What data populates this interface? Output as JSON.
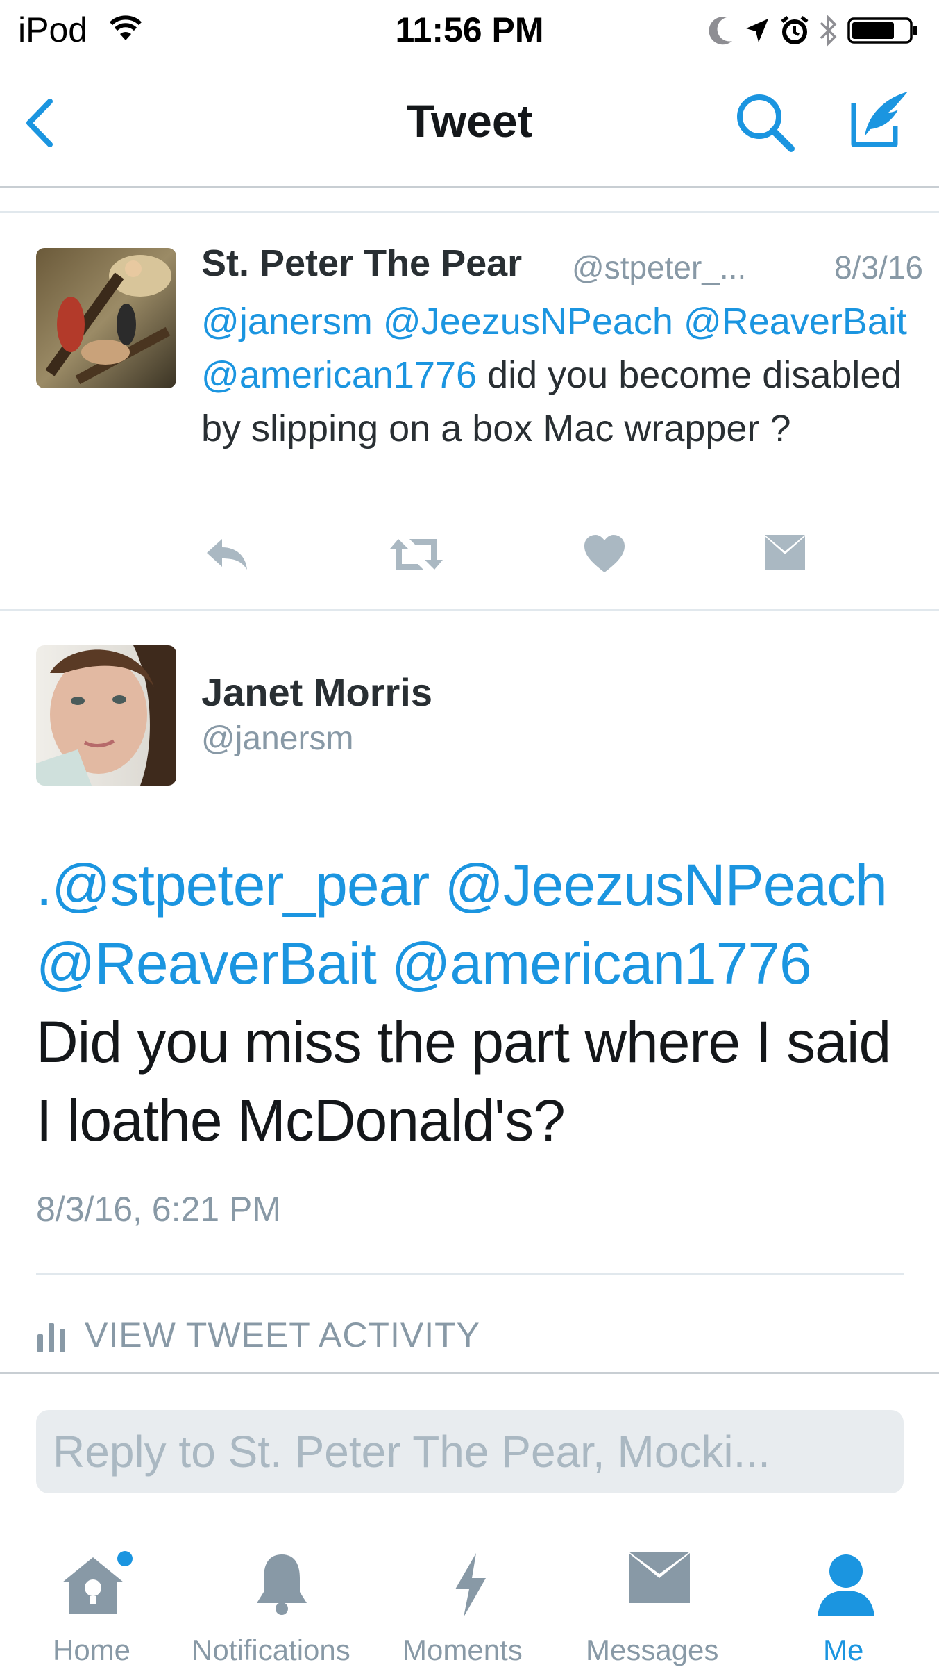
{
  "status_bar": {
    "carrier": "iPod",
    "time": "11:56 PM"
  },
  "nav": {
    "title": "Tweet"
  },
  "colors": {
    "accent": "#1b95e0",
    "muted": "#8899a6",
    "text": "#292f33"
  },
  "reply_tweet": {
    "name": "St. Peter The Pear",
    "handle": "@stpeter_...",
    "date": "8/3/16",
    "mention_1": "@janersm",
    "mention_2": "@JeezusNPeach",
    "mention_3": "@ReaverBait",
    "mention_4": "@american1776",
    "text_rest": "did you become disabled by slipping on a box Mac wrapper ?"
  },
  "main_tweet": {
    "name": "Janet Morris",
    "handle": "@janersm",
    "mention_1": ".@stpeter_pear",
    "mention_2": "@JeezusNPeach",
    "mention_3": "@ReaverBait",
    "mention_4": "@american1776",
    "text_rest": "Did you miss the part where I said I loathe McDonald's?",
    "timestamp": "8/3/16, 6:21 PM",
    "activity_label": "VIEW TWEET ACTIVITY"
  },
  "reply_box": {
    "placeholder": "Reply to St. Peter The Pear, Mocki..."
  },
  "tabs": [
    {
      "label": "Home",
      "icon": "home-icon"
    },
    {
      "label": "Notifications",
      "icon": "bell-icon"
    },
    {
      "label": "Moments",
      "icon": "lightning-icon"
    },
    {
      "label": "Messages",
      "icon": "envelope-icon"
    },
    {
      "label": "Me",
      "icon": "person-icon",
      "active": true
    }
  ]
}
